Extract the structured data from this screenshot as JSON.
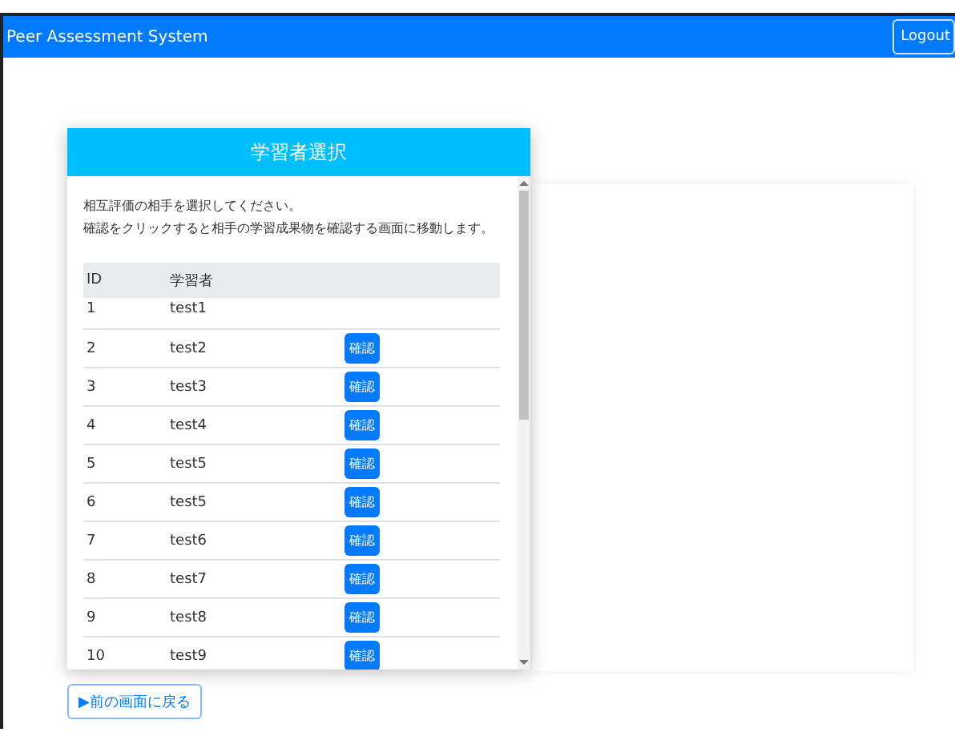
{
  "navbar": {
    "title": "Peer Assessment System",
    "logout": "Logout"
  },
  "dialog": {
    "title": "学習者選択",
    "instructions": [
      "相互評価の相手を選択してください。",
      "確認をクリックすると相手の学習成果物を確認する画面に移動します。"
    ],
    "table": {
      "columns": [
        "ID",
        "学習者"
      ],
      "rows": [
        {
          "id": "1",
          "name": "test1"
        },
        {
          "id": "2",
          "name": "test2",
          "button": "確認"
        },
        {
          "id": "3",
          "name": "test3",
          "button": "確認"
        },
        {
          "id": "4",
          "name": "test4",
          "button": "確認"
        },
        {
          "id": "5",
          "name": "test5",
          "button": "確認"
        },
        {
          "id": "6",
          "name": "test5",
          "button": "確認"
        },
        {
          "id": "7",
          "name": "test6",
          "button": "確認"
        },
        {
          "id": "8",
          "name": "test7",
          "button": "確認"
        },
        {
          "id": "9",
          "name": "test8",
          "button": "確認"
        },
        {
          "id": "10",
          "name": "test9",
          "button": "確認"
        }
      ]
    }
  },
  "back_button": "▶前の画面に戻る"
}
